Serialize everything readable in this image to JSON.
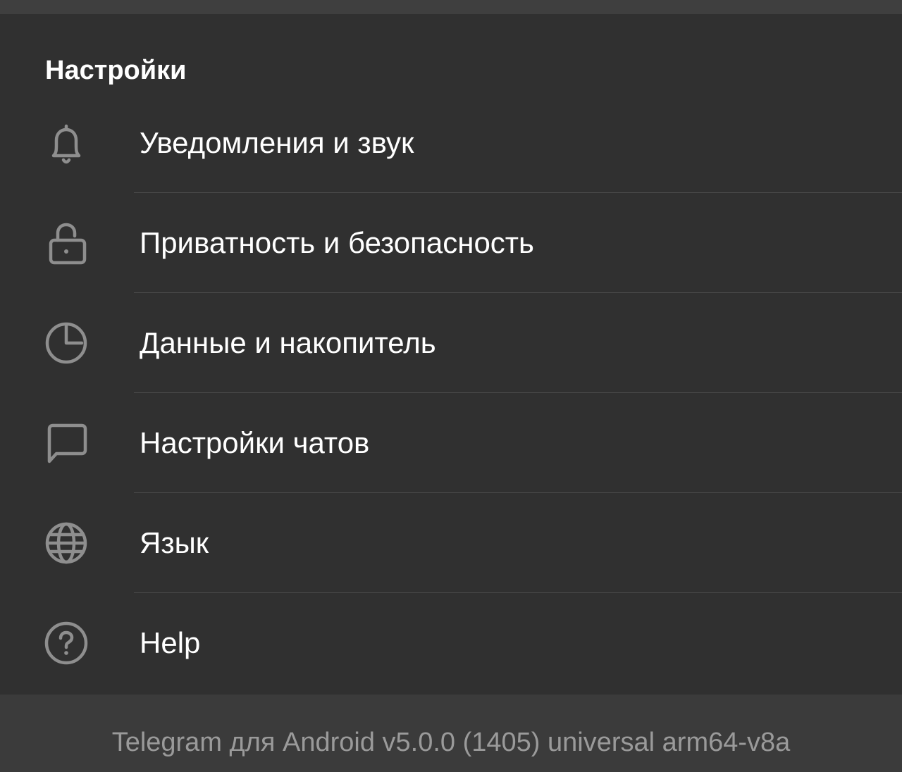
{
  "settings": {
    "section_title": "Настройки",
    "items": [
      {
        "label": "Уведомления и звук",
        "icon": "bell-icon"
      },
      {
        "label": "Приватность и безопасность",
        "icon": "lock-icon"
      },
      {
        "label": "Данные и накопитель",
        "icon": "pie-chart-icon"
      },
      {
        "label": "Настройки чатов",
        "icon": "chat-bubble-icon"
      },
      {
        "label": "Язык",
        "icon": "globe-icon"
      },
      {
        "label": "Help",
        "icon": "help-icon"
      }
    ]
  },
  "footer": {
    "version_text": "Telegram для Android v5.0.0 (1405) universal arm64-v8a"
  },
  "colors": {
    "background": "#303030",
    "footer_background": "#3b3b3b",
    "text": "#ffffff",
    "icon": "#8e8e8e",
    "footer_text": "#9a9a9a"
  }
}
